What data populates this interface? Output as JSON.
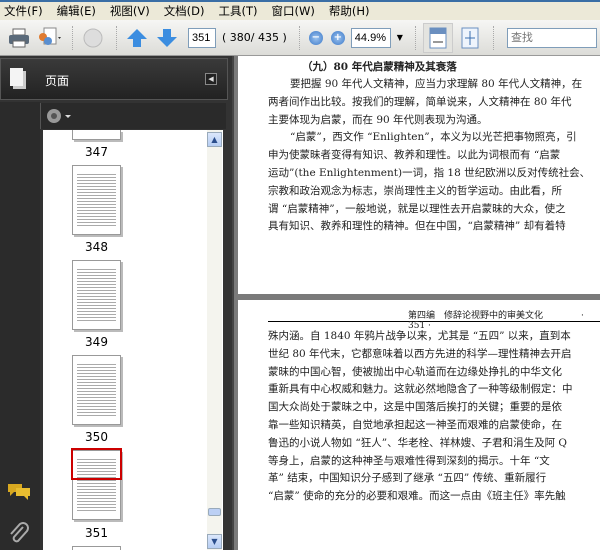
{
  "menu": [
    "文件(F)",
    "编辑(E)",
    "视图(V)",
    "文档(D)",
    "工具(T)",
    "窗口(W)",
    "帮助(H)"
  ],
  "toolbar": {
    "page_value": "351",
    "page_count": "( 380/ 435 )",
    "zoom_value": "44.9%",
    "search_placeholder": "查找"
  },
  "panel": {
    "title": "页面",
    "thumbnails": [
      "347",
      "348",
      "349",
      "350",
      "351"
    ],
    "selected": "351"
  },
  "page1": {
    "heading": "（九）80 年代启蒙精神及其衰落",
    "lines": [
      "要把握 90 年代人文精神，应当力求理解 80 年代人文精神，在",
      "两者间作出比较。按我们的理解，简单说来，人文精神在 80 年代",
      "主要体现为启蒙，而在 90 年代则表现为沟通。",
      "“启蒙”，西文作 “Enlighten”，本义为以光芒把事物照亮，引",
      "申为使蒙昧者变得有知识、教养和理性。以此为词根而有 “启蒙",
      "运动”(the Enlightenment)一词，指 18 世纪欧洲以反对传统社会、",
      "宗教和政治观念为标志，崇尚理性主义的哲学运动。由此看，所",
      "谓 “启蒙精神”，一般地说，就是以理性去开启蒙昧的大众，使之",
      "具有知识、教养和理性的精神。但在中国，“启蒙精神” 却有着特"
    ]
  },
  "page2": {
    "running_head": "第四编　修辞论视野中的审美文化",
    "page_number": "· 351 ·",
    "lines": [
      "殊内涵。自 1840 年鸦片战争以来，尤其是 “五四” 以来，直到本",
      "世纪 80 年代末，它都意味着以西方先进的科学—理性精神去开启",
      "蒙昧的中国心智，使被抛出中心轨道而在边缘处挣扎的中华文化",
      "重新具有中心权威和魅力。这就必然地隐含了一种等级制假定：中",
      "国大众尚处于蒙昧之中，这是中国落后挨打的关键；重要的是依",
      "靠一些知识精英，自觉地承担起这一神圣而艰难的启蒙使命，在",
      "鲁迅的小说人物如 “狂人”、华老栓、祥林嫂、子君和涓生及阿 Q",
      "等身上，启蒙的这种神圣与艰难性得到深刻的揭示。十年 “文",
      "革” 结束，中国知识分子感到了继承 “五四” 传统、重新履行",
      "“启蒙” 使命的充分的必要和艰难。而这一点由《班主任》率先触"
    ]
  }
}
